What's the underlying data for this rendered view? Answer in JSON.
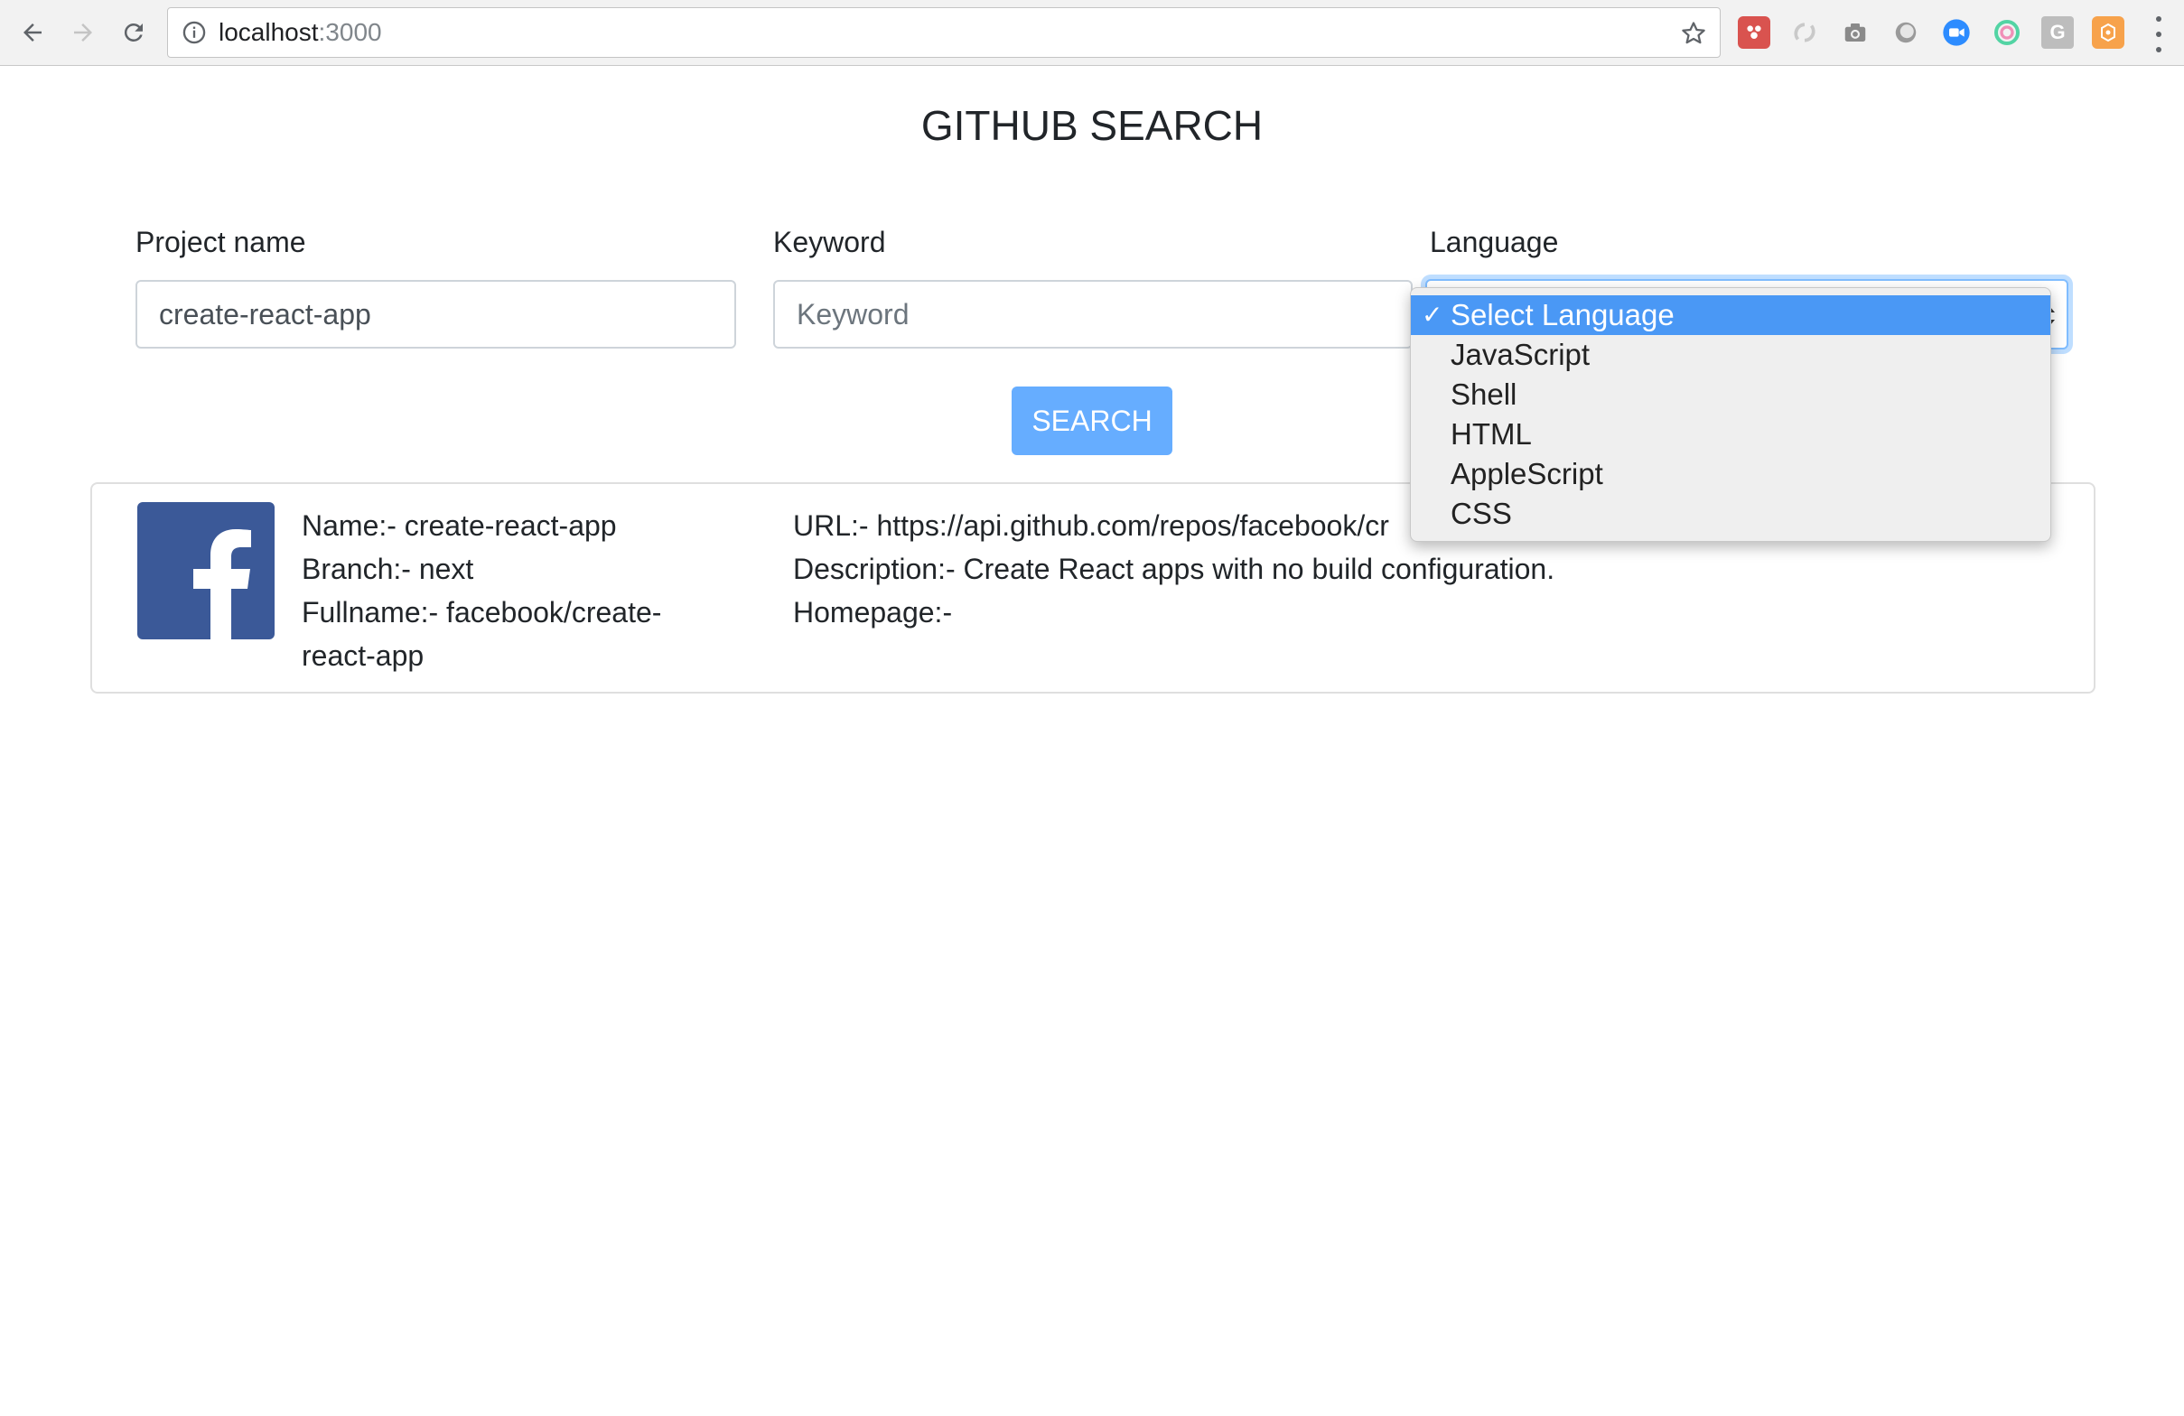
{
  "browser": {
    "url_host": "localhost",
    "url_port": ":3000",
    "extension_icons": [
      "ext-red-icon",
      "ext-gray-swirl-icon",
      "camera-icon",
      "ext-circle-icon",
      "zoom-video-icon",
      "ext-ring-icon",
      "grammarly-g-icon",
      "ext-orange-icon"
    ]
  },
  "page": {
    "title": "GITHUB SEARCH"
  },
  "form": {
    "project_label": "Project name",
    "project_value": "create-react-app",
    "keyword_label": "Keyword",
    "keyword_placeholder": "Keyword",
    "language_label": "Language",
    "search_label": "SEARCH"
  },
  "dropdown": {
    "options": [
      {
        "label": "Select Language",
        "selected": true,
        "check": "✓"
      },
      {
        "label": "JavaScript"
      },
      {
        "label": "Shell"
      },
      {
        "label": "HTML"
      },
      {
        "label": "AppleScript"
      },
      {
        "label": "CSS"
      }
    ]
  },
  "result": {
    "logo": "facebook-logo",
    "name": "Name:- create-react-app",
    "branch": "Branch:- next",
    "fullname_line1": "Fullname:- facebook/create-",
    "fullname_line2": "react-app",
    "url": "URL:- https://api.github.com/repos/facebook/cr",
    "description": "Description:- Create React apps with no build configuration.",
    "homepage": "Homepage:-"
  },
  "colors": {
    "primary_button": "#66adff",
    "selected_option": "#4a98f5",
    "facebook_blue": "#3b5998",
    "focus_border": "#80bdff"
  }
}
